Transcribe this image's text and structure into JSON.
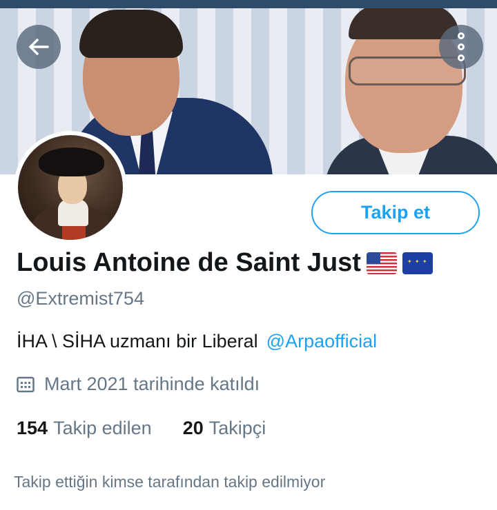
{
  "profile": {
    "display_name": "Louis Antoine de Saint Just",
    "name_flags": [
      "us-flag",
      "eu-flag"
    ],
    "handle": "@Extremist754",
    "bio_text": "İHA \\ SİHA uzmanı bir Liberal",
    "bio_mention": "@Arpaofficial",
    "joined": "Mart 2021 tarihinde katıldı",
    "following_count": "154",
    "following_label": "Takip edilen",
    "followers_count": "20",
    "followers_label": "Takipçi",
    "not_followed_note": "Takip ettiğin kimse tarafından takip edilmiyor"
  },
  "actions": {
    "follow_label": "Takip et"
  },
  "colors": {
    "accent": "#1da1f2",
    "secondary_text": "#657786",
    "primary_text": "#14171a"
  },
  "icons": {
    "back": "arrow-left-icon",
    "more": "more-vertical-icon",
    "calendar": "calendar-icon"
  }
}
